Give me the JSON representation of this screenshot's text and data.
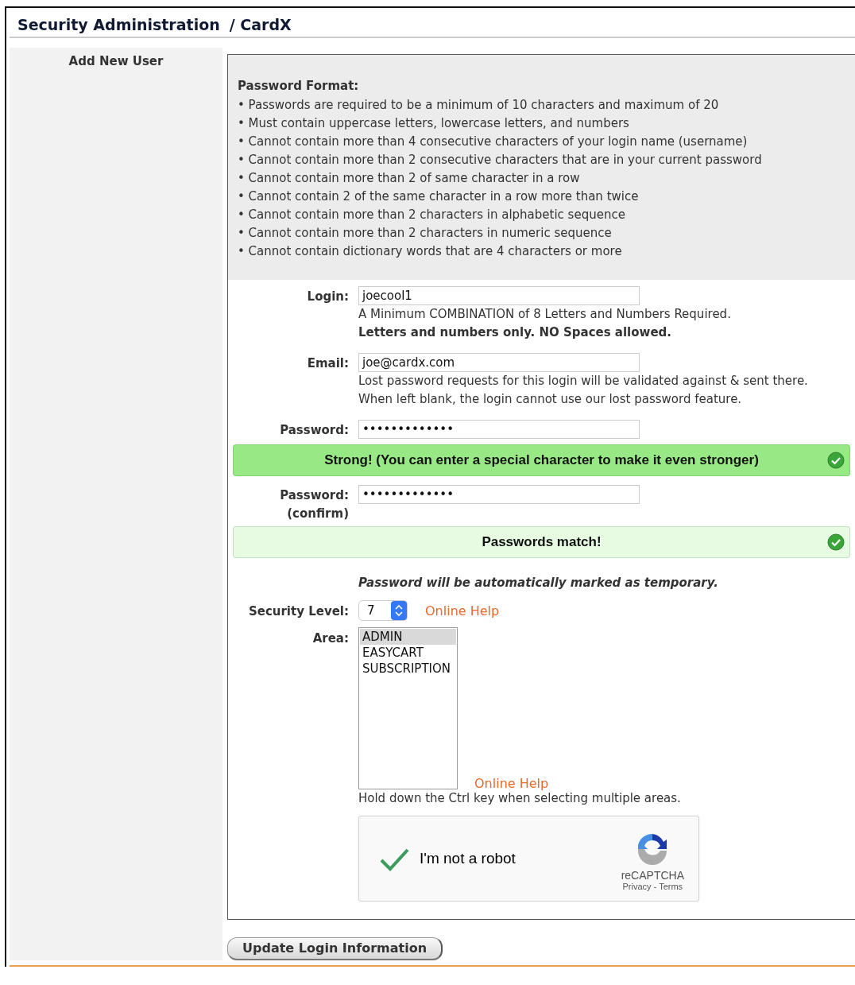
{
  "header": {
    "title": "Security Administration",
    "subtitle": "/ CardX"
  },
  "sidebar": {
    "title": "Add New User"
  },
  "password_format": {
    "title": "Password Format:",
    "rules": [
      "• Passwords are required to be a minimum of 10 characters and maximum of 20",
      "• Must contain uppercase letters, lowercase letters, and numbers",
      "• Cannot contain more than 4 consecutive characters of your login name (username)",
      "• Cannot contain more than 2 consecutive characters that are in your current password",
      "• Cannot contain more than 2 of same character in a row",
      "• Cannot contain 2 of the same character in a row more than twice",
      "• Cannot contain more than 2 characters in alphabetic sequence",
      "• Cannot contain more than 2 characters in numeric sequence",
      "• Cannot contain dictionary words that are 4 characters or more"
    ]
  },
  "form_rows": [
    {
      "kind": "text_field",
      "label": "Login:",
      "value": "joecool1",
      "notes": [
        {
          "text": "A Minimum COMBINATION of 8 Letters and Numbers Required.",
          "emphasis": false
        },
        {
          "text": "Letters and numbers only. NO Spaces allowed.",
          "emphasis": true
        }
      ]
    },
    {
      "kind": "text_field",
      "label": "Email:",
      "value": "joe@cardx.com",
      "notes": [
        {
          "text": "Lost password requests for this login will be validated against & sent there.",
          "emphasis": false
        },
        {
          "text": "When left blank, the login cannot use our lost password feature.",
          "emphasis": false
        }
      ]
    },
    {
      "kind": "text_field",
      "label": "Password:",
      "value": "•••••••••••••"
    },
    {
      "kind": "notice",
      "color": "#98e985",
      "text": "Strong! (You can enter a special character to make it even stronger)"
    },
    {
      "kind": "text_field",
      "label": "Password:",
      "sublabel": "(confirm)",
      "value": "•••••••••••••"
    },
    {
      "kind": "notice",
      "color": "#e6fbe2",
      "text": "Passwords match!"
    },
    {
      "kind": "note",
      "text": "Password will be automatically marked as temporary."
    },
    {
      "kind": "select",
      "label": "Security Level:",
      "value": "7",
      "link": "Online Help"
    },
    {
      "kind": "listbox",
      "label": "Area:",
      "options": [
        {
          "label": "ADMIN",
          "selected": true
        },
        {
          "label": "EASYCART",
          "selected": false
        },
        {
          "label": "SUBSCRIPTION",
          "selected": false
        }
      ],
      "link": "Online Help",
      "hint": "Hold down the Ctrl key when selecting multiple areas."
    },
    {
      "kind": "captcha",
      "checked": true,
      "label": "I'm not a robot",
      "brand": "reCAPTCHA",
      "links": "Privacy - Terms"
    }
  ],
  "submit": {
    "label": "Update Login Information"
  }
}
